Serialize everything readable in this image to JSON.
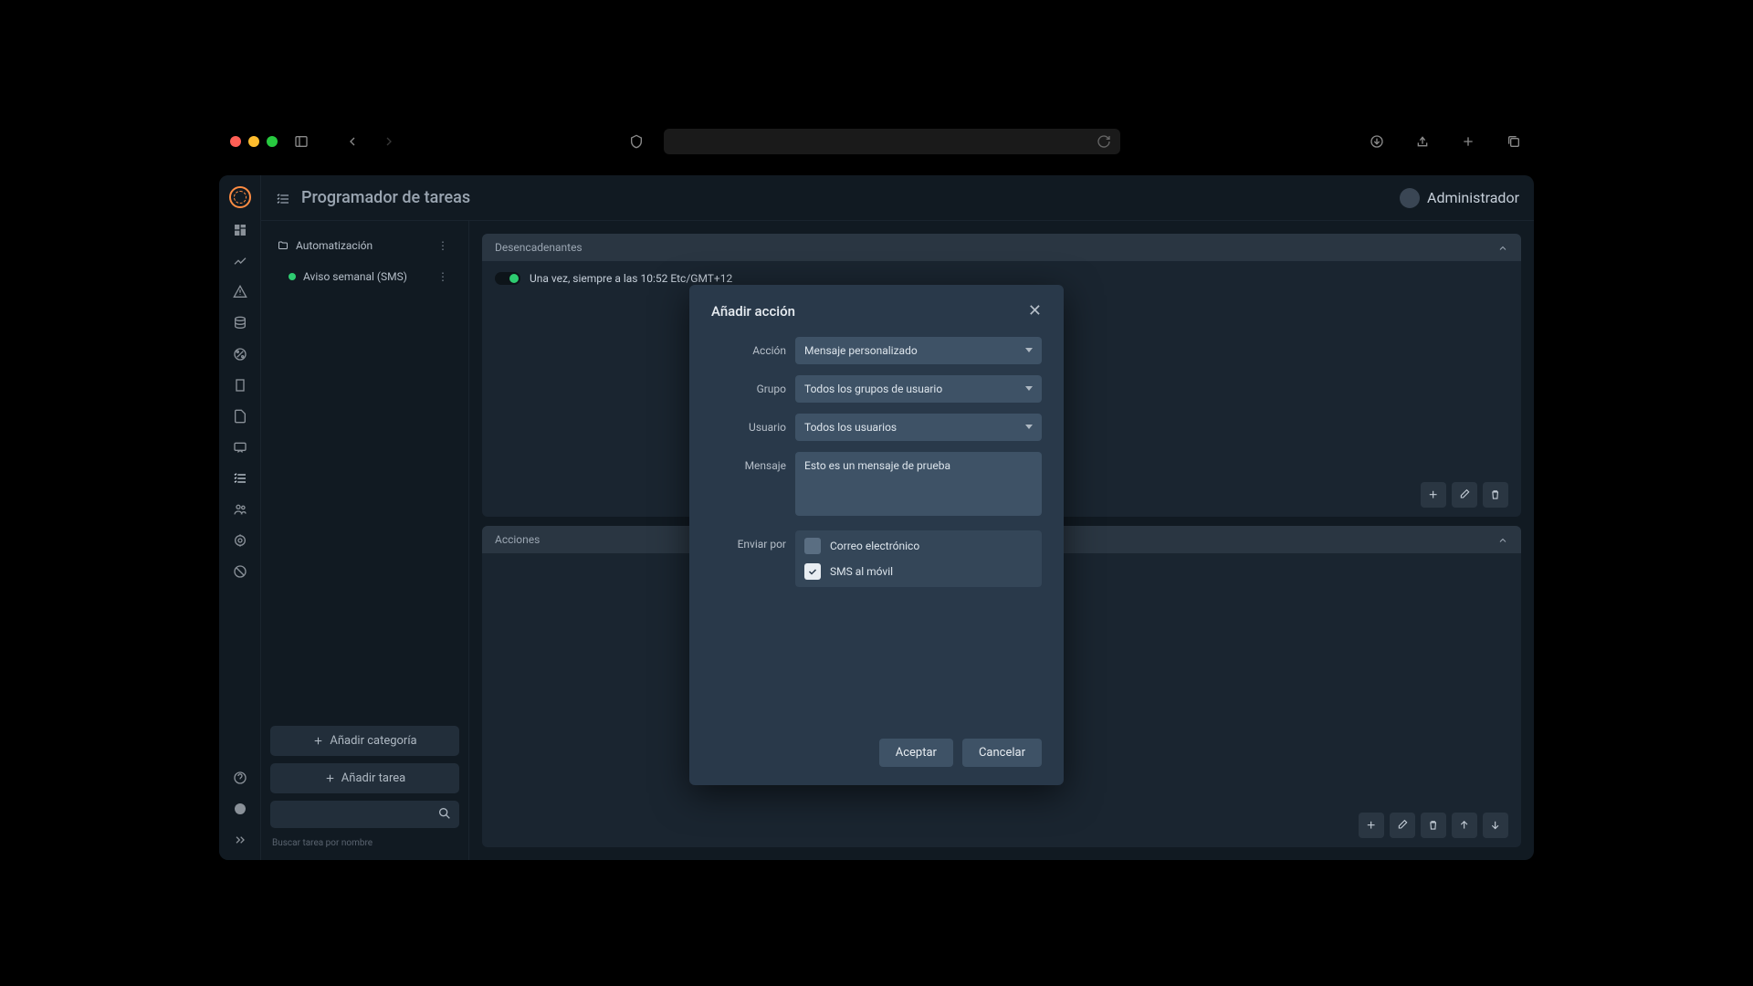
{
  "header": {
    "title": "Programador de tareas",
    "user": "Administrador"
  },
  "taskpanel": {
    "category": "Automatización",
    "task": "Aviso semanal (SMS)",
    "add_category": "Añadir categoría",
    "add_task": "Añadir tarea",
    "search_hint": "Buscar tarea por nombre"
  },
  "sections": {
    "triggers": {
      "title": "Desencadenantes",
      "item": "Una vez, siempre a las 10:52 Etc/GMT+12"
    },
    "actions": {
      "title": "Acciones"
    }
  },
  "modal": {
    "title": "Añadir acción",
    "labels": {
      "accion": "Acción",
      "grupo": "Grupo",
      "usuario": "Usuario",
      "mensaje": "Mensaje",
      "enviar": "Enviar por"
    },
    "values": {
      "accion": "Mensaje personalizado",
      "grupo": "Todos los grupos de usuario",
      "usuario": "Todos los usuarios",
      "mensaje": "Esto es un mensaje de prueba"
    },
    "checks": {
      "email": "Correo electrónico",
      "sms": "SMS al móvil"
    },
    "buttons": {
      "ok": "Aceptar",
      "cancel": "Cancelar"
    }
  }
}
